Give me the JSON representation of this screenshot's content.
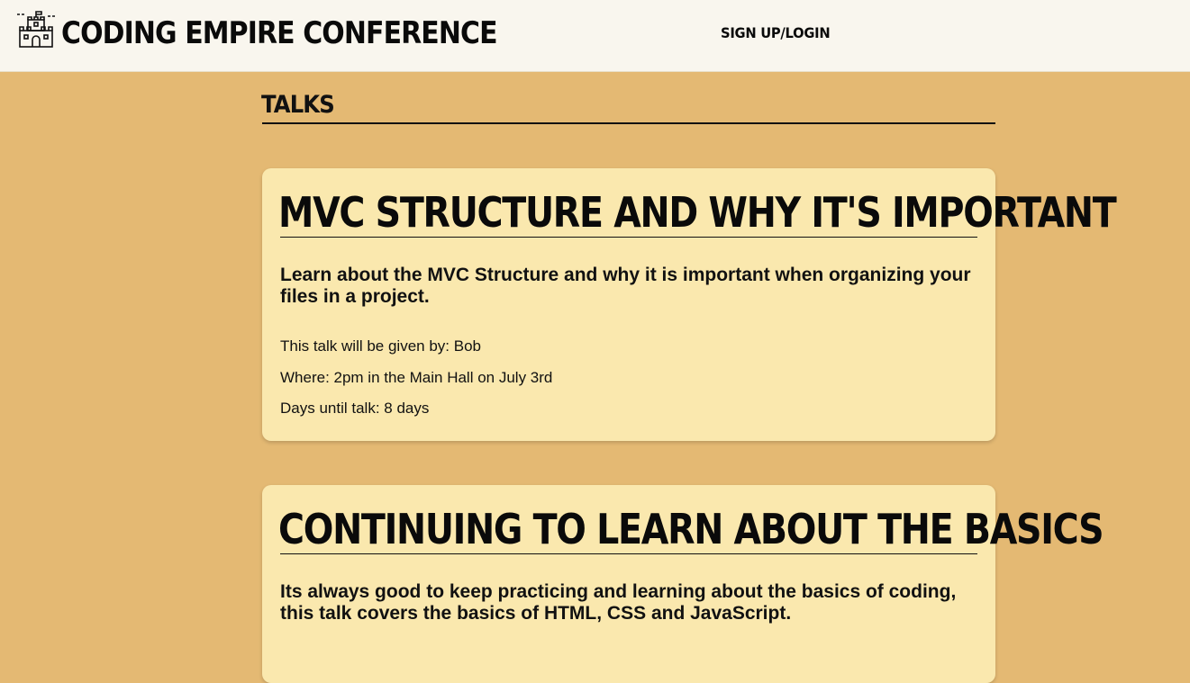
{
  "header": {
    "brand": "CODING EMPIRE CONFERENCE",
    "logo_icon": "castle-icon",
    "nav_link": "SIGN UP/LOGIN"
  },
  "section": {
    "title": "TALKS"
  },
  "talks": [
    {
      "title": "MVC STRUCTURE AND WHY IT'S IMPORTANT",
      "description": "Learn about the MVC Structure and why it is important when organizing your files in a project.",
      "speaker": "This talk will be given by: Bob",
      "where": "Where: 2pm in the Main Hall on July 3rd",
      "days_until": "Days until talk: 8 days"
    },
    {
      "title": "CONTINUING TO LEARN ABOUT THE BASICS",
      "description": "Its always good to keep practicing and learning about the basics of coding, this talk covers the basics of HTML, CSS and JavaScript."
    }
  ],
  "colors": {
    "page_background": "#e4b973",
    "header_background": "#f9f6ee",
    "card_background": "#fae8ae"
  }
}
